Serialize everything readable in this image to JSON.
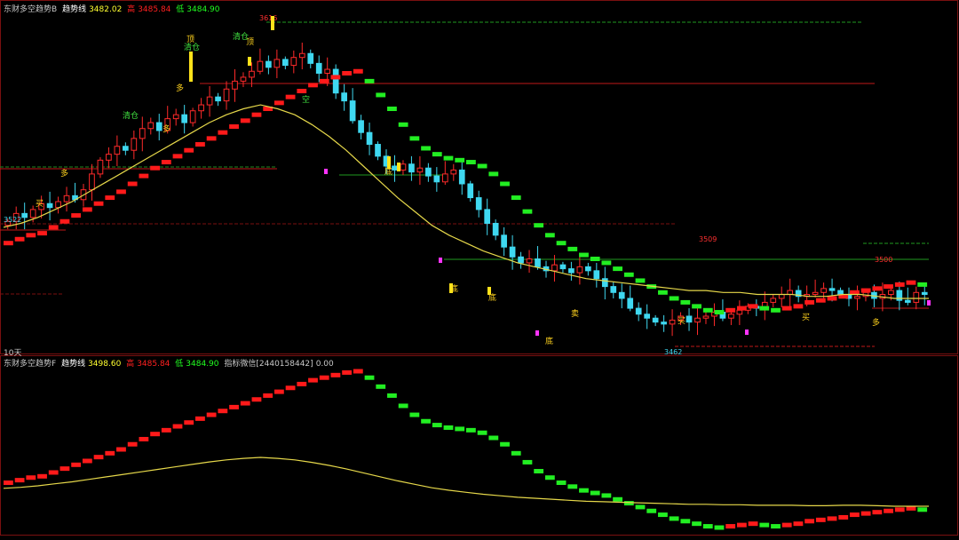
{
  "upper_header": {
    "name": "东财多空趋势B",
    "trend_label": "趋势线",
    "trend_value": "3482.02",
    "high_label": "高",
    "high_value": "3485.84",
    "low_label": "低",
    "low_value": "3484.90"
  },
  "lower_header": {
    "name": "东财多空趋势F",
    "trend_label": "趋势线",
    "trend_value": "3498.60",
    "high_label": "高",
    "high_value": "3485.84",
    "low_label": "低",
    "low_value": "3484.90",
    "extra_label": "指标微信[2440158442]",
    "extra_value": "0.00"
  },
  "period_label": "10天",
  "colors": {
    "background": "#000000",
    "up_candle": "#ff2a2a",
    "down_candle": "#3fd8f0",
    "trend_up": "#ff1a1a",
    "trend_down": "#22ee22",
    "ma_line": "#e6d84a",
    "signal_text": "#ffd21e",
    "grid": "#7a1010"
  },
  "chart_data": {
    "type": "candlestick",
    "ylim": [
      3455,
      3625
    ],
    "price_labels": [
      "3522",
      "3616",
      "3509",
      "3500",
      "3462"
    ],
    "signal_labels": [
      "多",
      "多",
      "多",
      "买",
      "顶",
      "清仓",
      "清仓",
      "顶",
      "清仓",
      "空",
      "底",
      "底",
      "底",
      "底",
      "卖",
      "买",
      "买",
      "多"
    ],
    "close": [
      3521,
      3525,
      3523,
      3527,
      3530,
      3528,
      3531,
      3534,
      3532,
      3537,
      3545,
      3552,
      3555,
      3559,
      3557,
      3563,
      3568,
      3571,
      3567,
      3573,
      3575,
      3571,
      3577,
      3580,
      3584,
      3582,
      3588,
      3592,
      3594,
      3597,
      3602,
      3599,
      3603,
      3600,
      3604,
      3606,
      3601,
      3596,
      3598,
      3586,
      3582,
      3572,
      3566,
      3560,
      3554,
      3549,
      3547,
      3550,
      3546,
      3548,
      3544,
      3541,
      3545,
      3547,
      3540,
      3533,
      3527,
      3520,
      3514,
      3508,
      3503,
      3500,
      3502,
      3498,
      3496,
      3499,
      3497,
      3495,
      3498,
      3496,
      3492,
      3488,
      3485,
      3482,
      3477,
      3474,
      3472,
      3470,
      3469,
      3471,
      3473,
      3470,
      3472,
      3473,
      3475,
      3472,
      3474,
      3476,
      3478,
      3477,
      3480,
      3482,
      3484,
      3486,
      3483,
      3484,
      3485,
      3487,
      3486,
      3484,
      3482,
      3483,
      3485,
      3482,
      3484,
      3486,
      3481,
      3480,
      3485,
      3484
    ],
    "trend": [
      3510,
      3512,
      3514,
      3515,
      3518,
      3521,
      3524,
      3527,
      3530,
      3533,
      3536,
      3540,
      3544,
      3548,
      3551,
      3554,
      3557,
      3560,
      3563,
      3566,
      3569,
      3572,
      3575,
      3578,
      3581,
      3584,
      3587,
      3590,
      3592,
      3594,
      3596,
      3597,
      3592,
      3585,
      3578,
      3570,
      3563,
      3558,
      3555,
      3553,
      3552,
      3551,
      3549,
      3545,
      3540,
      3533,
      3526,
      3519,
      3514,
      3510,
      3507,
      3504,
      3502,
      3500,
      3497,
      3494,
      3491,
      3488,
      3485,
      3482,
      3480,
      3478,
      3476,
      3475,
      3476,
      3477,
      3478,
      3477,
      3476,
      3477,
      3478,
      3480,
      3481,
      3482,
      3483,
      3485,
      3486,
      3487,
      3488,
      3489,
      3490,
      3489
    ],
    "ma": [
      3518,
      3520,
      3523,
      3527,
      3531,
      3536,
      3541,
      3546,
      3551,
      3556,
      3561,
      3566,
      3571,
      3575,
      3578,
      3580,
      3578,
      3575,
      3570,
      3564,
      3557,
      3549,
      3541,
      3533,
      3526,
      3519,
      3514,
      3510,
      3506,
      3503,
      3500,
      3498,
      3496,
      3494,
      3492,
      3491,
      3490,
      3489,
      3488,
      3487,
      3486,
      3486,
      3485,
      3485,
      3484,
      3484,
      3484,
      3483,
      3483,
      3484,
      3484,
      3483,
      3482,
      3482,
      3482
    ]
  }
}
